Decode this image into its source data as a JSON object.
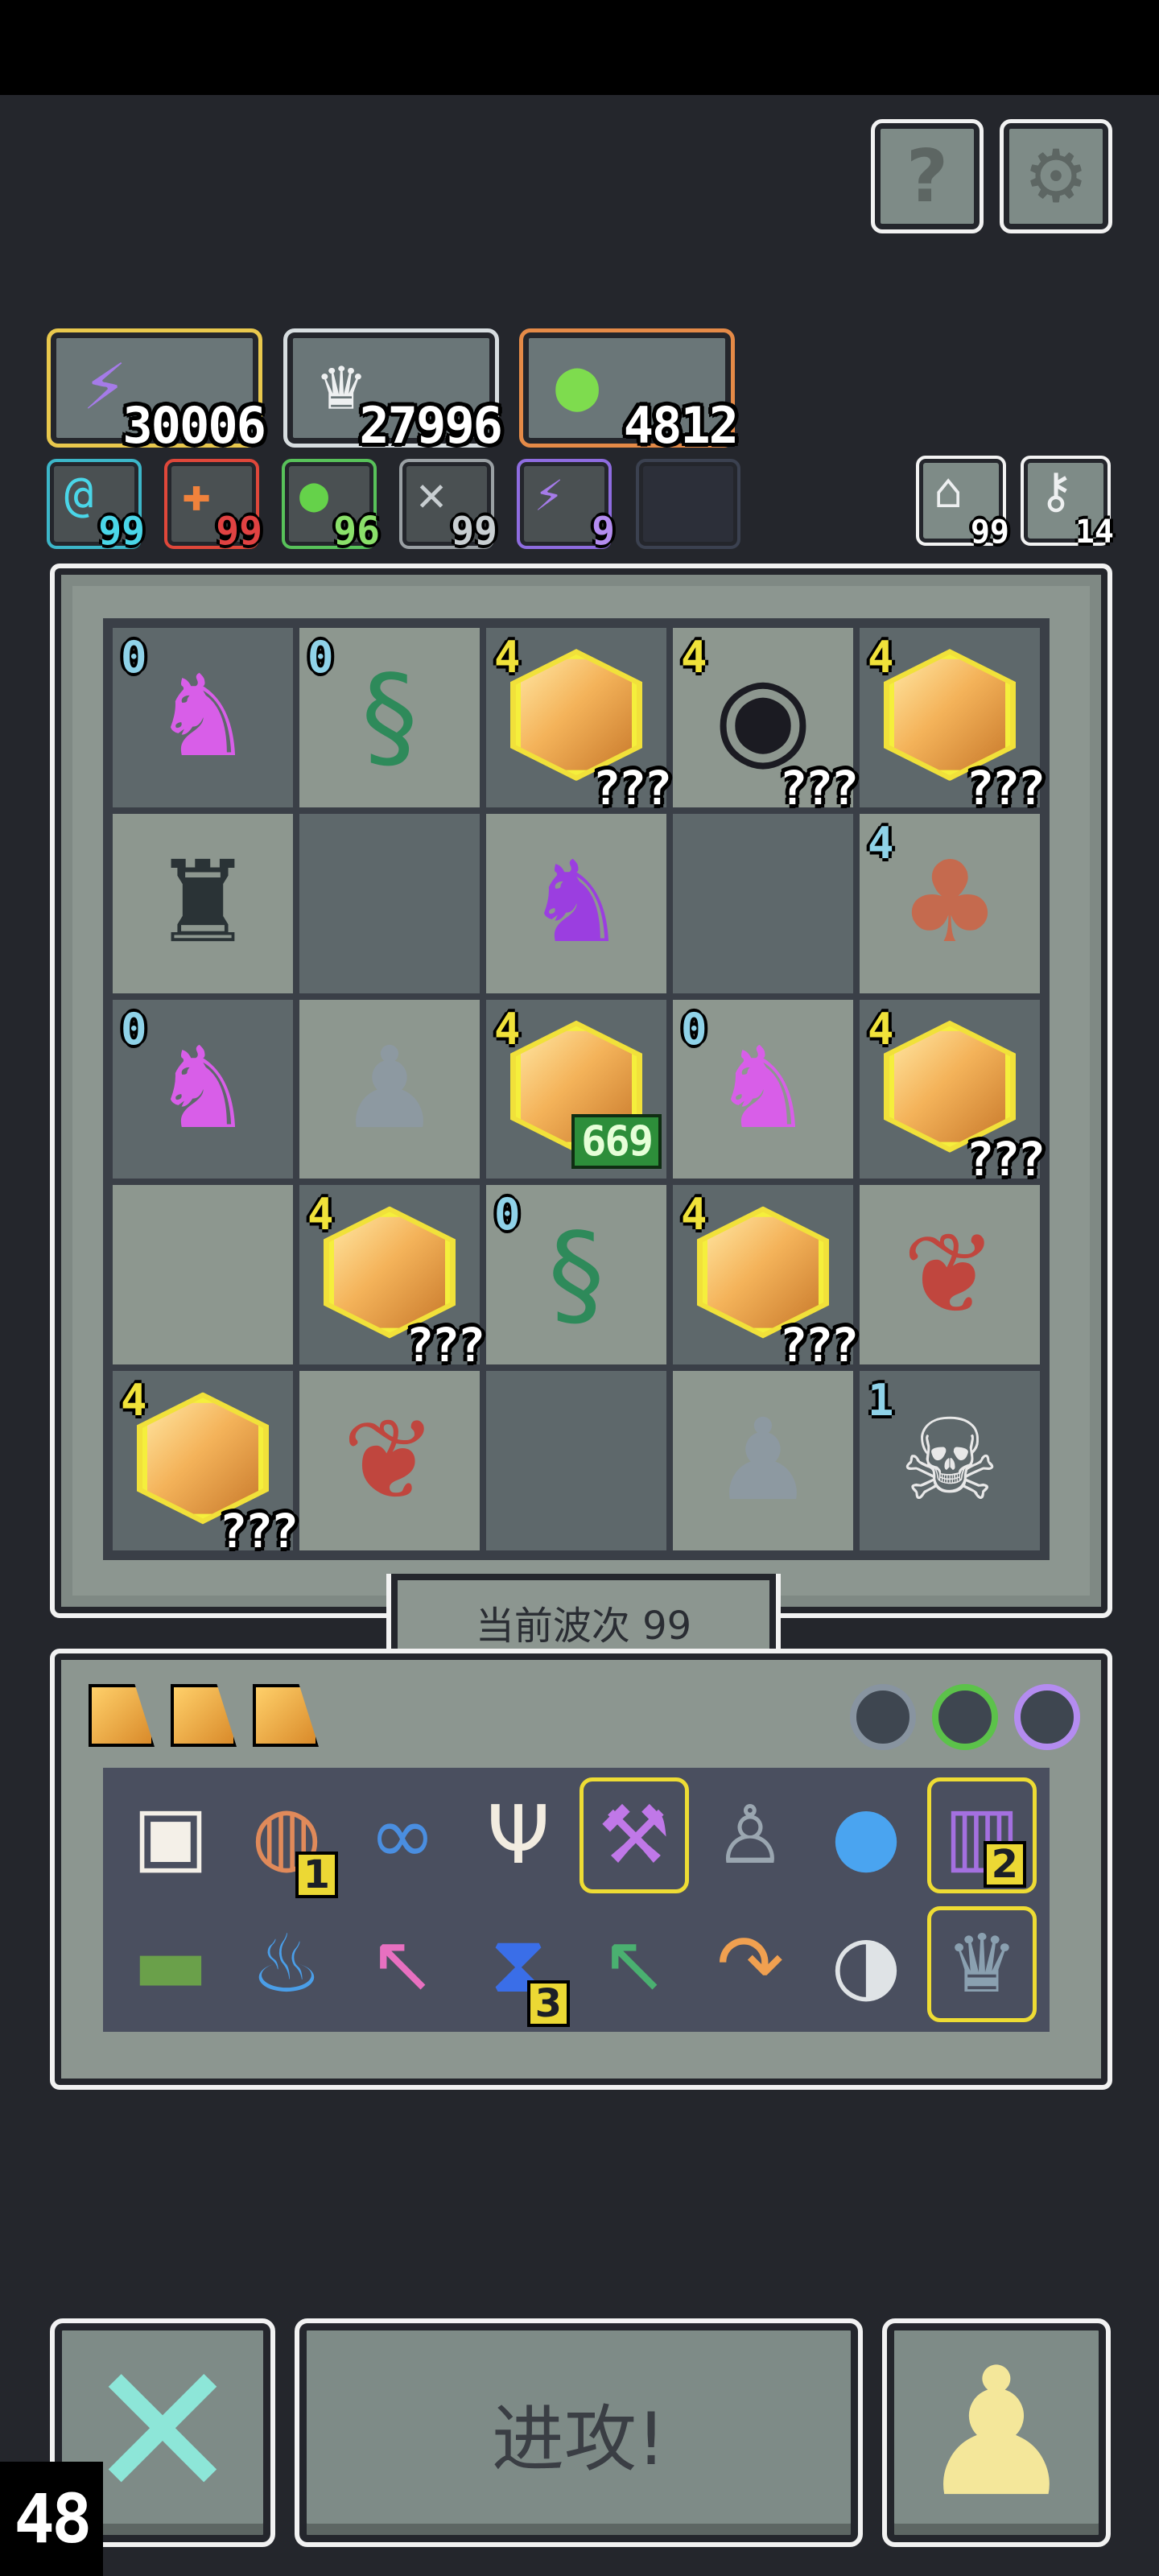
{
  "top_buttons": {
    "help_label": "?",
    "settings_icon": "gear-icon"
  },
  "resources": [
    {
      "icon": "lightning-icon",
      "value": "30006",
      "border": "#e9c84d",
      "glyph": "⚡",
      "color": "#a57be8"
    },
    {
      "icon": "crown-icon",
      "value": "27996",
      "border": "#d7dde0",
      "glyph": "♛",
      "color": "#eef0f1"
    },
    {
      "icon": "gourd-icon",
      "value": "4812",
      "border": "#e58a47",
      "glyph": "●",
      "color": "#7edc4e"
    }
  ],
  "chips": [
    {
      "icon": "swirl-icon",
      "value": "99",
      "border": "#3cb6c9",
      "glyph": "@",
      "color": "#4ad6e8",
      "ncolor": "#4ad6e8"
    },
    {
      "icon": "cross-icon",
      "value": "99",
      "border": "#e0473a",
      "glyph": "✚",
      "color": "#f0823c",
      "ncolor": "#e04242"
    },
    {
      "icon": "bean-icon",
      "value": "96",
      "border": "#58c25a",
      "glyph": "●",
      "color": "#65d24a",
      "ncolor": "#8ae06a"
    },
    {
      "icon": "wing-icon",
      "value": "99",
      "border": "#9aa0a4",
      "glyph": "✕",
      "color": "#c8ced1",
      "ncolor": "#c8ced1"
    },
    {
      "icon": "bolt-icon",
      "value": "9",
      "border": "#8e6ce0",
      "glyph": "⚡",
      "color": "#a57be8",
      "ncolor": "#b48cf0"
    }
  ],
  "right_chips": [
    {
      "icon": "house-icon",
      "value": "99",
      "glyph": "⌂"
    },
    {
      "icon": "key-icon",
      "value": "14",
      "glyph": "⚷"
    }
  ],
  "board": {
    "cells": [
      {
        "shade": "dark",
        "unit": "demon-icon",
        "glyph": "♞",
        "color": "#d85ee8",
        "level": "0",
        "level_color": "#8fd2e8"
      },
      {
        "shade": "light",
        "unit": "serpent-icon",
        "glyph": "§",
        "color": "#2e8a5a",
        "level": "0",
        "level_color": "#8fd2e8"
      },
      {
        "shade": "dark",
        "unit": "gem-icon",
        "glyph": "gem",
        "level": "4",
        "level_color": "#f0e23a",
        "tag": "???"
      },
      {
        "shade": "light",
        "unit": "eye-portal-icon",
        "glyph": "◉",
        "color": "#1b1b22",
        "level": "4",
        "level_color": "#f0e23a",
        "tag": "???"
      },
      {
        "shade": "dark",
        "unit": "gem-icon",
        "glyph": "gem",
        "level": "4",
        "level_color": "#f0e23a",
        "tag": "???"
      },
      {
        "shade": "light",
        "unit": "cthulhu-icon",
        "glyph": "♜",
        "color": "#2a3336"
      },
      {
        "shade": "dark",
        "unit": "empty"
      },
      {
        "shade": "light",
        "unit": "purple-golem-icon",
        "glyph": "♞",
        "color": "#9b3ee0"
      },
      {
        "shade": "dark",
        "unit": "empty"
      },
      {
        "shade": "light",
        "unit": "mushroom-icon",
        "glyph": "♣",
        "color": "#c56a4e",
        "level": "4",
        "level_color": "#8fd2e8"
      },
      {
        "shade": "dark",
        "unit": "demon-icon",
        "glyph": "♞",
        "color": "#d85ee8",
        "level": "0",
        "level_color": "#8fd2e8"
      },
      {
        "shade": "light",
        "unit": "stone-golem-icon",
        "glyph": "♟",
        "color": "#8d99a1"
      },
      {
        "shade": "dark",
        "unit": "crystal-icon",
        "glyph": "gem",
        "level": "4",
        "level_color": "#f0e23a",
        "count": "669"
      },
      {
        "shade": "light",
        "unit": "demon-icon",
        "glyph": "♞",
        "color": "#d85ee8",
        "level": "0",
        "level_color": "#8fd2e8"
      },
      {
        "shade": "dark",
        "unit": "gem-icon",
        "glyph": "gem",
        "level": "4",
        "level_color": "#f0e23a",
        "tag": "???"
      },
      {
        "shade": "light",
        "unit": "empty"
      },
      {
        "shade": "dark",
        "unit": "gem-icon",
        "glyph": "gem",
        "level": "4",
        "level_color": "#f0e23a",
        "tag": "???"
      },
      {
        "shade": "light",
        "unit": "serpent-icon",
        "glyph": "§",
        "color": "#2e8a5a",
        "level": "0",
        "level_color": "#8fd2e8"
      },
      {
        "shade": "dark",
        "unit": "gem-icon",
        "glyph": "gem",
        "level": "4",
        "level_color": "#f0e23a",
        "tag": "???"
      },
      {
        "shade": "light",
        "unit": "thorn-plant-icon",
        "glyph": "❦",
        "color": "#c0463e"
      },
      {
        "shade": "dark",
        "unit": "gem-icon",
        "glyph": "gem",
        "level": "4",
        "level_color": "#f0e23a",
        "tag": "???"
      },
      {
        "shade": "light",
        "unit": "thorn-plant-icon",
        "glyph": "❦",
        "color": "#c0463e"
      },
      {
        "shade": "dark",
        "unit": "empty"
      },
      {
        "shade": "light",
        "unit": "stone-golem-icon",
        "glyph": "♟",
        "color": "#8d99a1"
      },
      {
        "shade": "dark",
        "unit": "skeleton-mage-icon",
        "glyph": "☠",
        "color": "#e8e8e8",
        "level": "1",
        "level_color": "#8fd2e8"
      }
    ]
  },
  "wave_label": "当前波次 99",
  "inventory": {
    "tabs": [
      "tab-1",
      "tab-2",
      "tab-3"
    ],
    "equip": [
      {
        "icon": "beetle-icon",
        "color": "#8894a0"
      },
      {
        "icon": "green-orb-icon",
        "color": "#5cc24a"
      },
      {
        "icon": "ring-icon",
        "color": "#b48cf0"
      }
    ],
    "items": [
      {
        "icon": "scroll-icon",
        "glyph": "▣",
        "color": "#f4f0e8"
      },
      {
        "icon": "eye-potion-icon",
        "glyph": "◍",
        "color": "#e08a5a",
        "badge": "1"
      },
      {
        "icon": "goggles-icon",
        "glyph": "∞",
        "color": "#4a8ee0"
      },
      {
        "icon": "claw-icon",
        "glyph": "Ψ",
        "color": "#f2ece0"
      },
      {
        "icon": "purple-axe-icon",
        "glyph": "⚒",
        "color": "#c078e8",
        "highlight": true
      },
      {
        "icon": "joystick-icon",
        "glyph": "♙",
        "color": "#9aa6b0"
      },
      {
        "icon": "crystal-ball-icon",
        "glyph": "●",
        "color": "#4aa4f0"
      },
      {
        "icon": "jar-icon",
        "glyph": "▥",
        "color": "#a470e0",
        "badge": "2",
        "highlight": true
      },
      {
        "icon": "toothed-chest-icon",
        "glyph": "▬",
        "color": "#6aa04a"
      },
      {
        "icon": "blue-flame-icon",
        "glyph": "♨",
        "color": "#4a9ee8"
      },
      {
        "icon": "pink-arrow-icon",
        "glyph": "↖",
        "color": "#e870c0"
      },
      {
        "icon": "hourglass-icon",
        "glyph": "⧗",
        "color": "#3a6ee8",
        "badge": "3"
      },
      {
        "icon": "green-arrow-icon",
        "glyph": "↖",
        "color": "#4ab070"
      },
      {
        "icon": "horn-icon",
        "glyph": "↷",
        "color": "#f0a050"
      },
      {
        "icon": "white-orb-icon",
        "glyph": "◑",
        "color": "#dfe3e6"
      },
      {
        "icon": "spiky-crown-icon",
        "glyph": "♛",
        "color": "#8aa0b0",
        "highlight": true
      }
    ]
  },
  "bottom": {
    "attack_label": "进攻!",
    "corner_counter": "48"
  }
}
